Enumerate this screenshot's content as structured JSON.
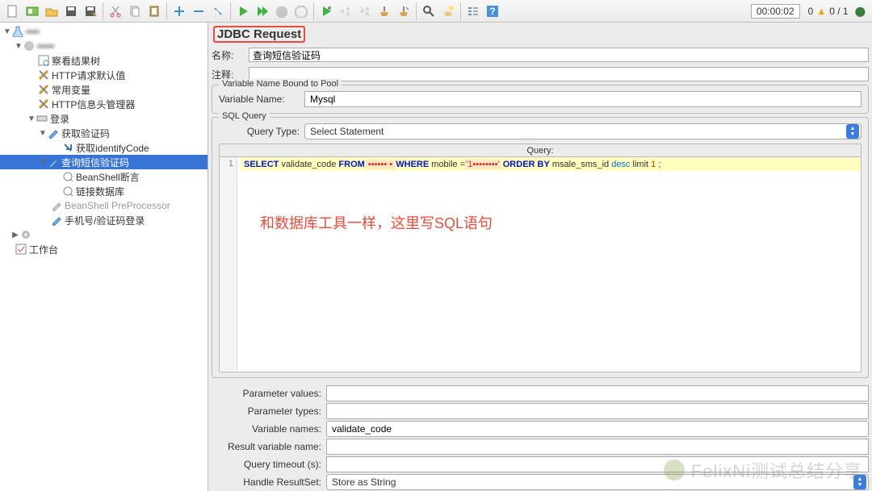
{
  "status": {
    "timer": "00:00:02",
    "num_left": "0",
    "num_right": "0 / 1"
  },
  "tree": {
    "n0": "",
    "n1": "察看结果树",
    "n2": "HTTP请求默认值",
    "n3": "常用变量",
    "n4": "HTTP信息头管理器",
    "n5": "登录",
    "n6": "获取验证码",
    "n7": "获取identifyCode",
    "n8": "查询短信验证码",
    "n9": "BeanShell断言",
    "n10": "链接数据库",
    "n11": "BeanShell PreProcessor",
    "n12": "手机号/验证码登录",
    "n13": "工作台"
  },
  "panel": {
    "title": "JDBC Request",
    "name_lbl": "名称:",
    "name_val": "查询短信验证码",
    "comment_lbl": "注释:",
    "comment_val": "",
    "pool_group": "Variable Name Bound to Pool",
    "var_name_lbl": "Variable Name:",
    "var_name_val": "Mysql",
    "sql_group": "SQL Query",
    "query_type_lbl": "Query Type:",
    "query_type_val": "Select Statement",
    "query_hdr": "Query:",
    "sql_line_num": "1",
    "sql_parts": {
      "select": "SELECT",
      "col": " validate_code ",
      "from": "FROM",
      "tbl": " ▪▪▪▪▪▪ ▪ ",
      "where": "WHERE",
      "cond": " mobile =",
      "lit": "'1▪▪▪▪▪▪▪▪'",
      "orderby": " ORDER BY",
      "ordercol": " msale_sms_id ",
      "desc": "desc",
      "limit": " limit ",
      "one": "1",
      "semi": " ;"
    },
    "annotation": "和数据库工具一样，这里写SQL语句",
    "params": {
      "pv_lbl": "Parameter values:",
      "pv_val": "",
      "pt_lbl": "Parameter types:",
      "pt_val": "",
      "vn_lbl": "Variable names:",
      "vn_val": "validate_code",
      "rv_lbl": "Result variable name:",
      "rv_val": "",
      "qt_lbl": "Query timeout (s):",
      "qt_val": "",
      "hr_lbl": "Handle ResultSet:",
      "hr_val": "Store as String"
    }
  },
  "watermark": "FelixNi测试总结分享"
}
